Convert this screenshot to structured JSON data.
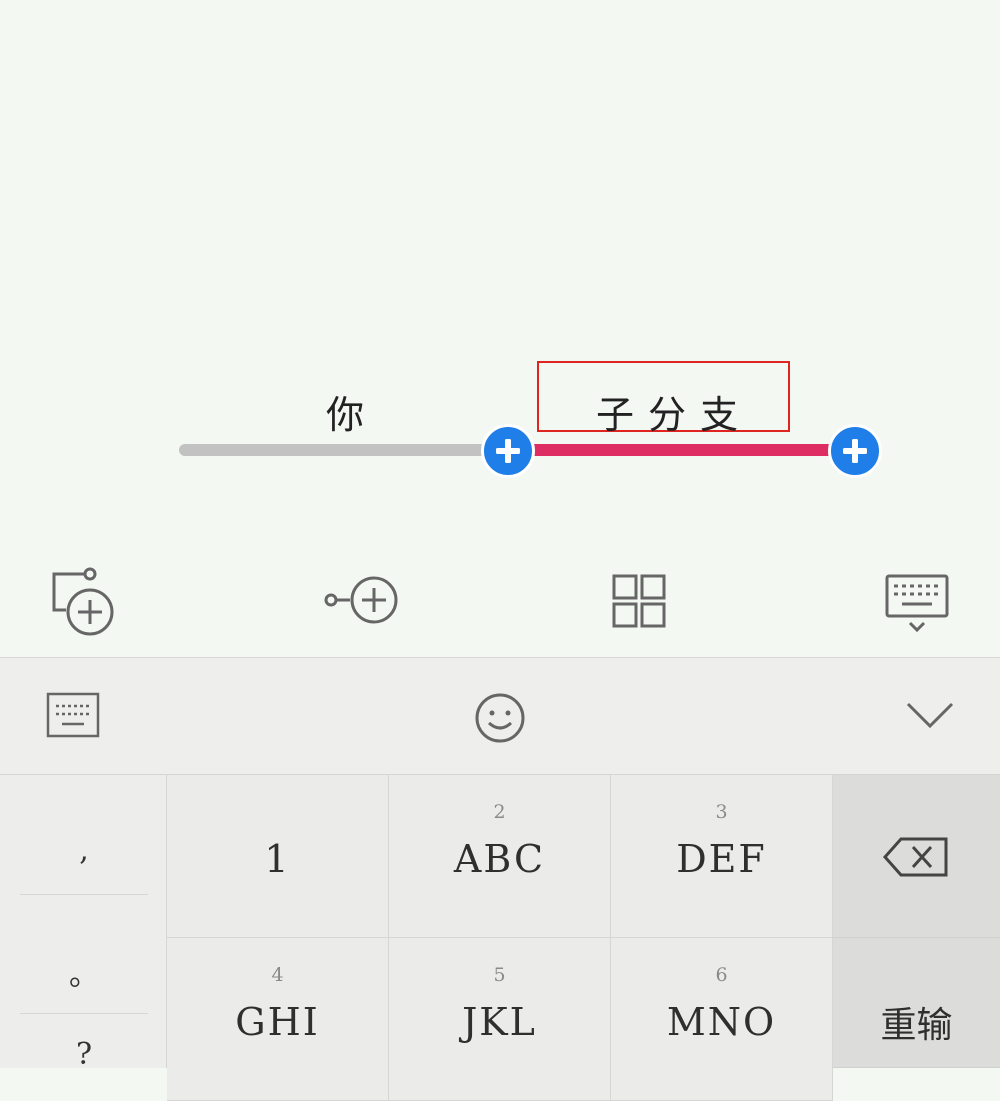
{
  "mindmap": {
    "root_text": "你",
    "child_text": "子分支",
    "colors": {
      "root_line": "#c2c2c2",
      "child_line": "#dd2d62",
      "add_button": "#1f7ee8",
      "selection_box": "#e02420"
    }
  },
  "toolbar": {
    "icons": [
      "add-subnode-icon",
      "add-sibling-icon",
      "layout-grid-icon",
      "keyboard-icon"
    ]
  },
  "keyboard": {
    "symbols": [
      ",",
      "。",
      "?"
    ],
    "keys": [
      {
        "num": "",
        "label": "1"
      },
      {
        "num": "2",
        "label": "ABC"
      },
      {
        "num": "3",
        "label": "DEF"
      },
      {
        "num": "4",
        "label": "GHI"
      },
      {
        "num": "5",
        "label": "JKL"
      },
      {
        "num": "6",
        "label": "MNO"
      }
    ],
    "retype_label": "重输"
  }
}
